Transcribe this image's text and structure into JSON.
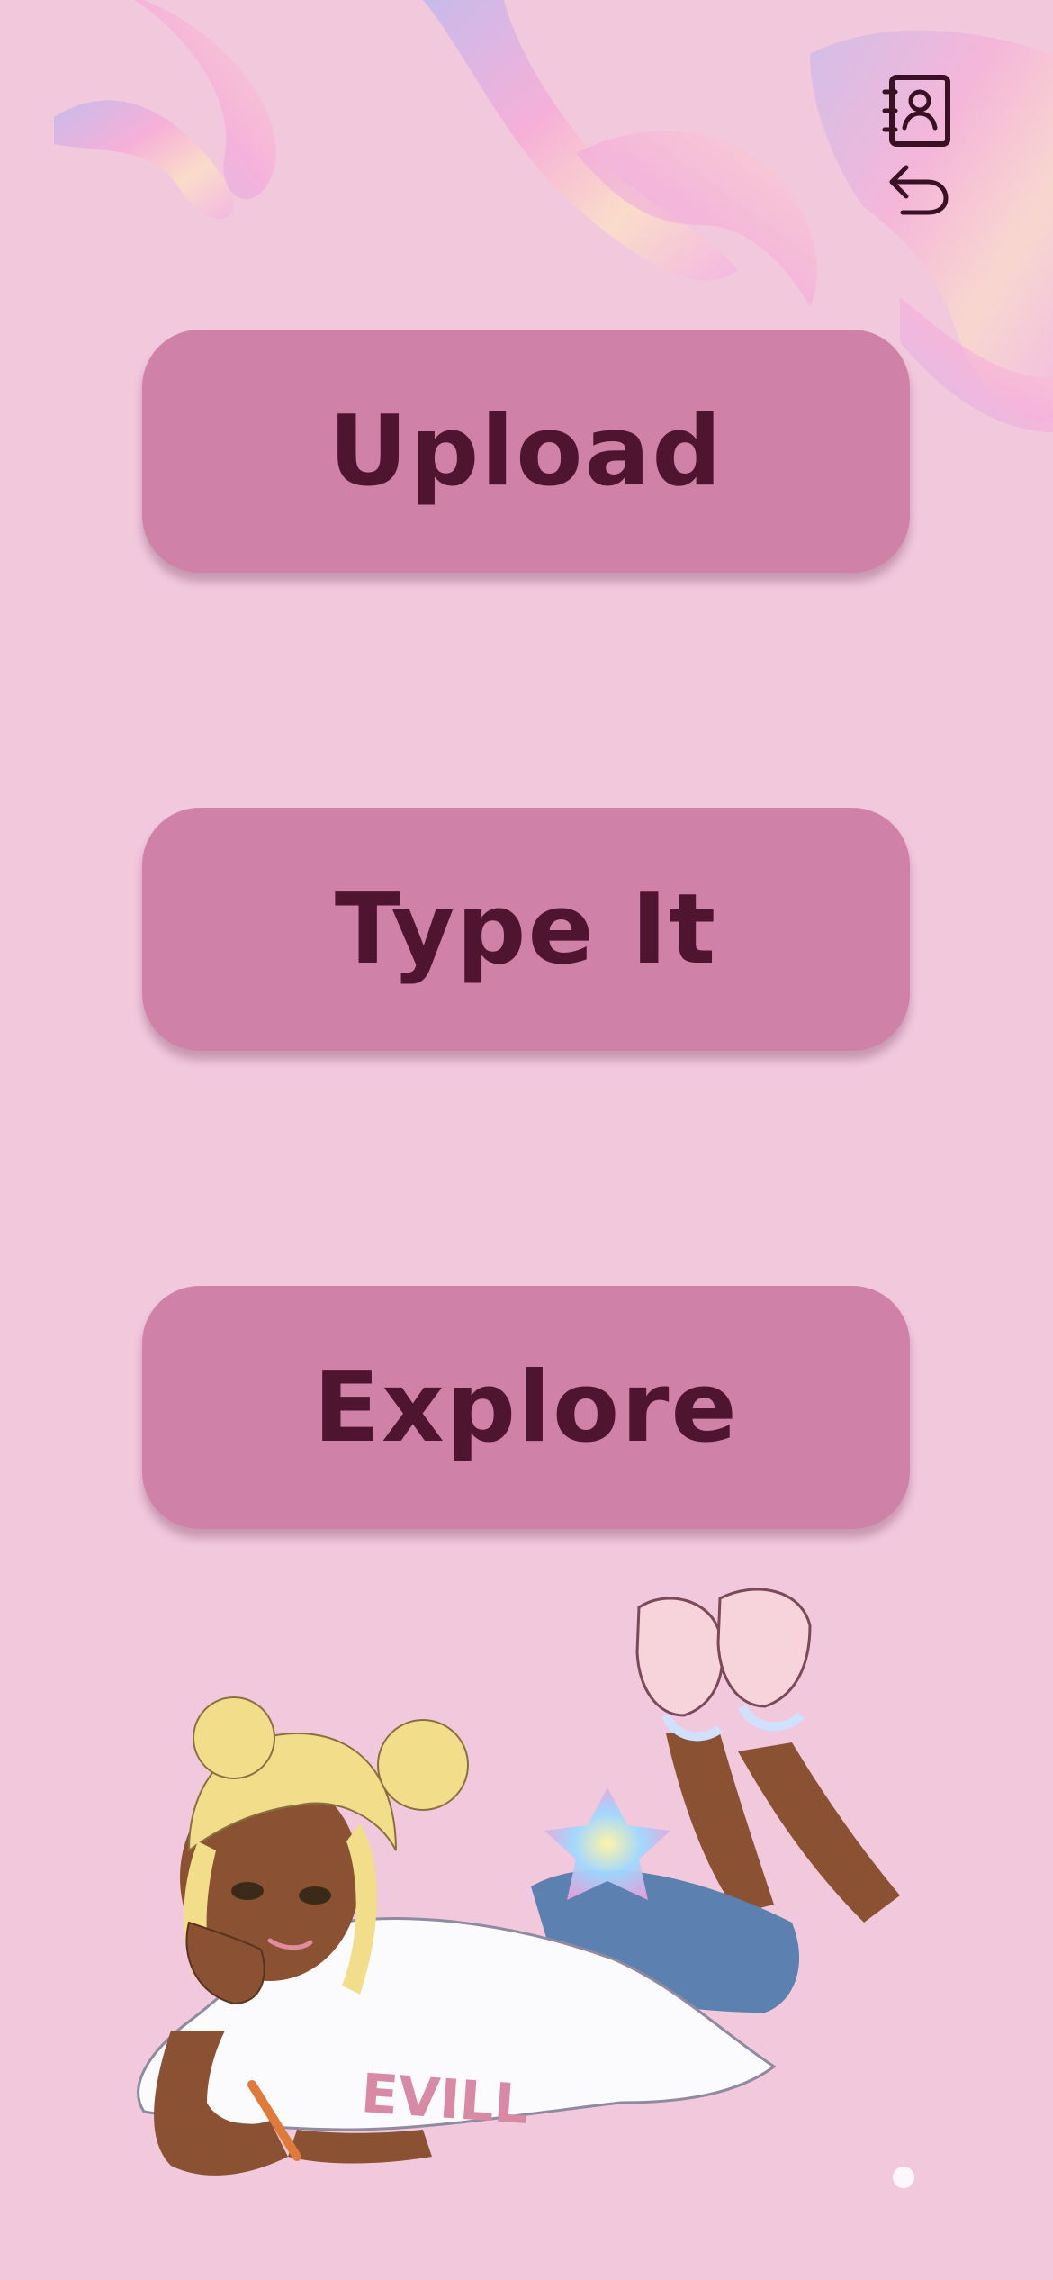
{
  "colors": {
    "background": "#f2c8dd",
    "button": "#cf81a8",
    "button_text": "#4f1530",
    "icon": "#3a1024"
  },
  "top_icons": {
    "contacts": "contacts-book-icon",
    "back": "undo-arrow-icon"
  },
  "menu": {
    "upload_label": "Upload",
    "type_label": "Type It",
    "explore_label": "Explore"
  },
  "illustration": {
    "shirt_text": "EVILL"
  }
}
